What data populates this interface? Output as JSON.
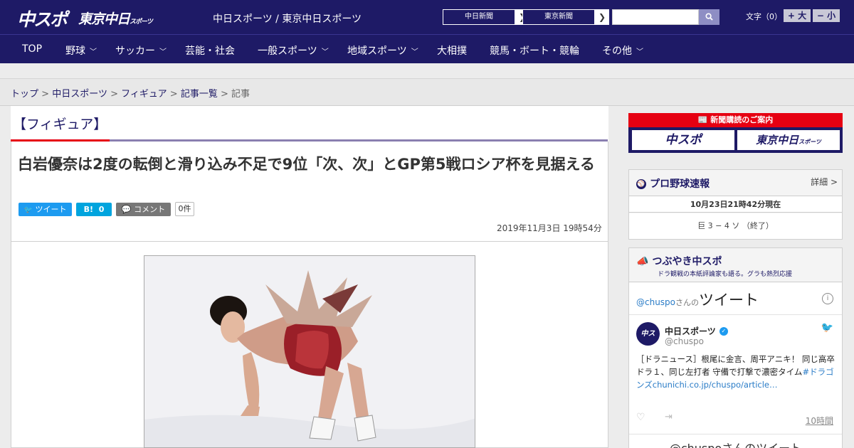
{
  "header": {
    "logo_main": "中スポ",
    "logo_tokyo": "東京中日",
    "logo_tokyo_sub": "スポーツ",
    "site_name": "中日スポーツ / 東京中日スポーツ",
    "partner_links": [
      "中日新聞",
      "東京新聞"
    ],
    "font_label": "文字（0）",
    "font_larger": "+ 大",
    "font_smaller": "− 小"
  },
  "nav": {
    "items": [
      {
        "label": "TOP",
        "dropdown": false
      },
      {
        "label": "野球",
        "dropdown": true
      },
      {
        "label": "サッカー",
        "dropdown": true
      },
      {
        "label": "芸能・社会",
        "dropdown": false
      },
      {
        "label": "一般スポーツ",
        "dropdown": true
      },
      {
        "label": "地域スポーツ",
        "dropdown": true
      },
      {
        "label": "大相撲",
        "dropdown": false
      },
      {
        "label": "競馬・ボート・競輪",
        "dropdown": false
      },
      {
        "label": "その他",
        "dropdown": true
      }
    ]
  },
  "breadcrumb": {
    "items": [
      "トップ",
      "中日スポーツ",
      "フィギュア",
      "記事一覧"
    ],
    "current": "記事",
    "separator": ">"
  },
  "article": {
    "category": "【フィギュア】",
    "title": "白岩優奈は2度の転倒と滑り込み不足で9位「次、次」とGP第5戦ロシア杯を見据える",
    "tweet_label": "ツイート",
    "hatena_label": "B!",
    "hatena_count": "0",
    "comment_label": "コメント",
    "comment_count": "0件",
    "date": "2019年11月3日 19時54分"
  },
  "sidebar": {
    "ad_title": "新聞購読のご案内",
    "ad_logo_1": "中スポ",
    "ad_logo_2": "東京中日",
    "ad_logo_2_sub": "スポーツ",
    "baseball": {
      "title": "プロ野球速報",
      "detail_link": "詳細 >",
      "timestamp": "10月23日21時42分現在",
      "score": "巨 3 − 4 ソ （終了）"
    },
    "tsubuyaki": {
      "title": "つぶやき中スポ",
      "subtitle": "ドラ観戦の本紙評論家も語る。グラも熱烈応援",
      "timeline_handle": "@chuspo",
      "timeline_handle_suffix": "さんの",
      "timeline_label": "ツイート",
      "tweet_name": "中日スポーツ",
      "tweet_handle": "@chuspo",
      "tweet_text": "［ドラニュース］根尾に金言、周平アニキ！ 同じ高卒ドラ１、同じ左打者 守備で打撃で濃密タイム",
      "tweet_hashtag": "#ドラゴンズ",
      "tweet_link": "chunichi.co.jp/chuspo/article…",
      "tweet_time": "10時間",
      "footer_text": "@chuspoさんのツイート"
    }
  },
  "colors": {
    "brand_navy": "#1e1a66",
    "accent_red": "#e60012",
    "twitter_blue": "#1d9bf0",
    "hatena_blue": "#00a4de"
  }
}
